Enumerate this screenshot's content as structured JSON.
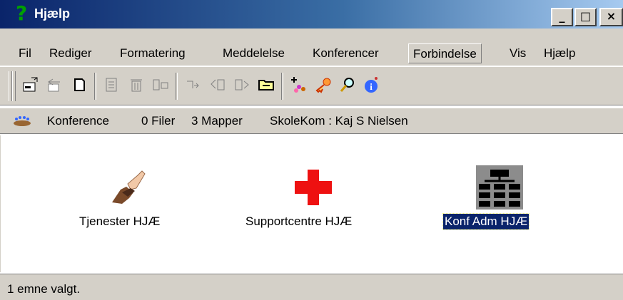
{
  "window": {
    "title": "Hjælp",
    "minimize": "_",
    "maximize": "□",
    "close": "×"
  },
  "menu": [
    {
      "label": "Fil"
    },
    {
      "label": "Rediger"
    },
    {
      "label": "Formatering"
    },
    {
      "label": "Meddelelse"
    },
    {
      "label": "Konferencer"
    },
    {
      "label": "Forbindelse"
    },
    {
      "label": "Vis"
    },
    {
      "label": "Hjælp"
    }
  ],
  "toolbar_icons": [
    "new-message-icon",
    "reply-icon",
    "new-document-icon",
    "properties-icon",
    "delete-icon",
    "move-icon",
    "forward-icon",
    "previous-unread-icon",
    "next-unread-icon",
    "folder-icon",
    "members-icon",
    "key-icon",
    "search-icon",
    "info-icon"
  ],
  "infobar": {
    "location": "Konference",
    "files": "0 Filer",
    "folders": "3 Mapper",
    "user": "SkoleKom : Kaj S Nielsen"
  },
  "items": [
    {
      "label": "Tjenester HJÆ",
      "icon": "handshake-icon",
      "selected": false
    },
    {
      "label": "Supportcentre HJÆ",
      "icon": "red-cross-icon",
      "selected": false
    },
    {
      "label": "Konf Adm HJÆ",
      "icon": "org-chart-icon",
      "selected": true
    }
  ],
  "status": {
    "text": "1 emne valgt."
  }
}
